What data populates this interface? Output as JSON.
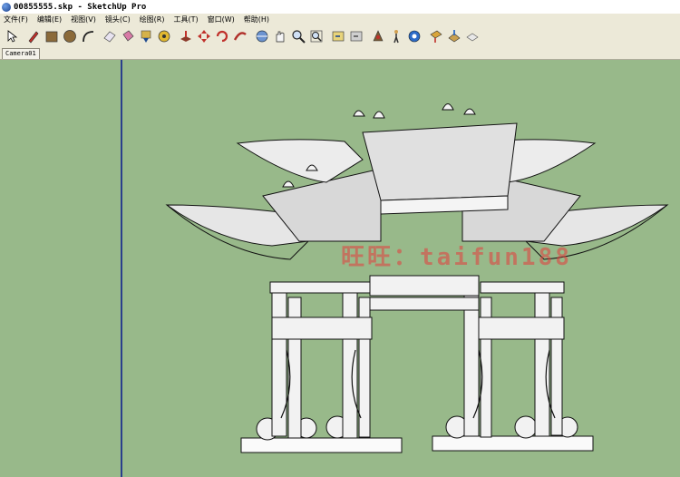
{
  "window": {
    "title": "00855555.skp - SketchUp Pro",
    "icon": "sketchup-logo-icon"
  },
  "menu": [
    {
      "label": "文件(F)"
    },
    {
      "label": "编辑(E)"
    },
    {
      "label": "视图(V)"
    },
    {
      "label": "镜头(C)"
    },
    {
      "label": "绘图(R)"
    },
    {
      "label": "工具(T)"
    },
    {
      "label": "窗口(W)"
    },
    {
      "label": "帮助(H)"
    }
  ],
  "toolbar": {
    "tools": [
      "select-icon",
      "pencil-icon",
      "rectangle-icon",
      "circle-icon",
      "arc-icon",
      "eraser-icon",
      "paint-bucket-icon",
      "make-component-icon",
      "tape-measure-icon",
      "push-pull-icon",
      "move-icon",
      "rotate-icon",
      "follow-me-icon",
      "orbit-icon",
      "pan-icon",
      "zoom-icon",
      "zoom-extents-icon",
      "previous-view-icon",
      "next-view-icon",
      "position-camera-icon",
      "walk-icon",
      "look-around-icon",
      "section-plane-icon",
      "get-models-icon",
      "share-model-icon"
    ]
  },
  "scene_tabs": [
    {
      "label": "Camera01"
    }
  ],
  "viewport": {
    "background": "#98b98a",
    "axis_color": "#2a3f8c",
    "model": "chinese-memorial-archway-paifang",
    "watermark": "旺旺：taifun188"
  }
}
